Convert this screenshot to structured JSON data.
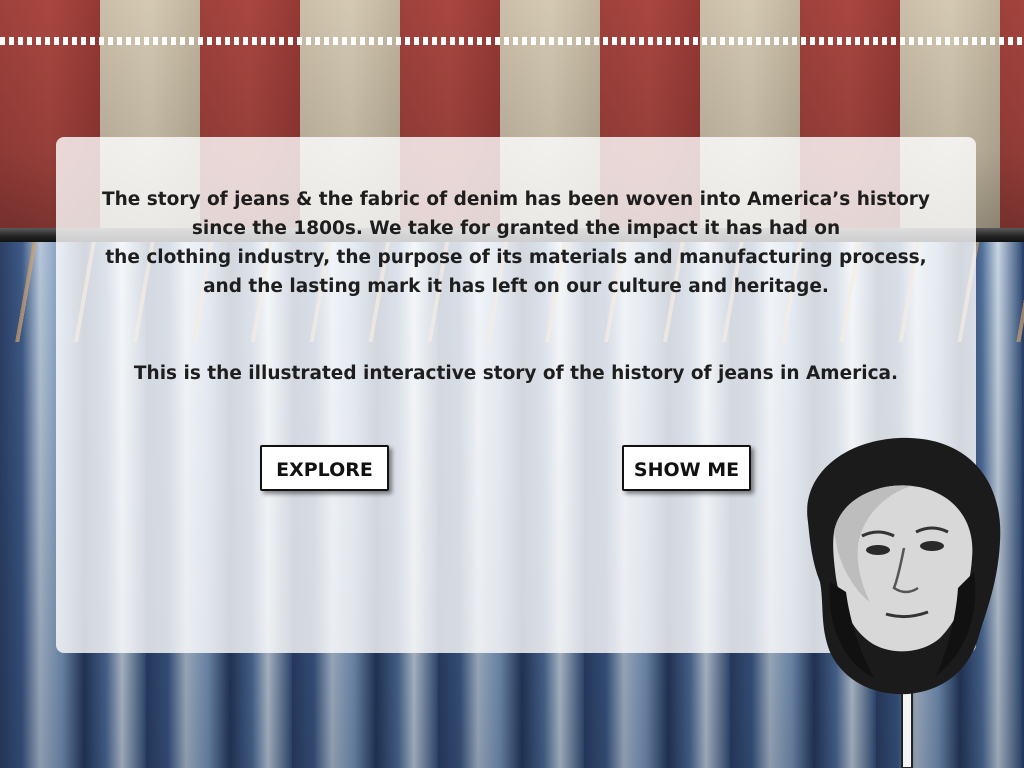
{
  "intro": {
    "lines": [
      "The story of jeans & the fabric of denim has been woven into America’s history",
      "since the 1800s. We take for granted the impact it has had on",
      "the clothing industry, the purpose of its materials  and manufacturing process,",
      "and the lasting mark it has left on our culture and heritage."
    ]
  },
  "tagline": "This is the illustrated interactive story of the history of jeans in America.",
  "buttons": {
    "explore": "EXPLORE",
    "show_me": "SHOW ME"
  },
  "icons": {
    "portrait": "bearded-man-portrait-on-stick"
  },
  "colors": {
    "flag_red": "#a7443f",
    "flag_cream": "#d5c8b1",
    "denim": "#3d5a86",
    "panel": "#ffffff",
    "text": "#1e1e1e"
  }
}
